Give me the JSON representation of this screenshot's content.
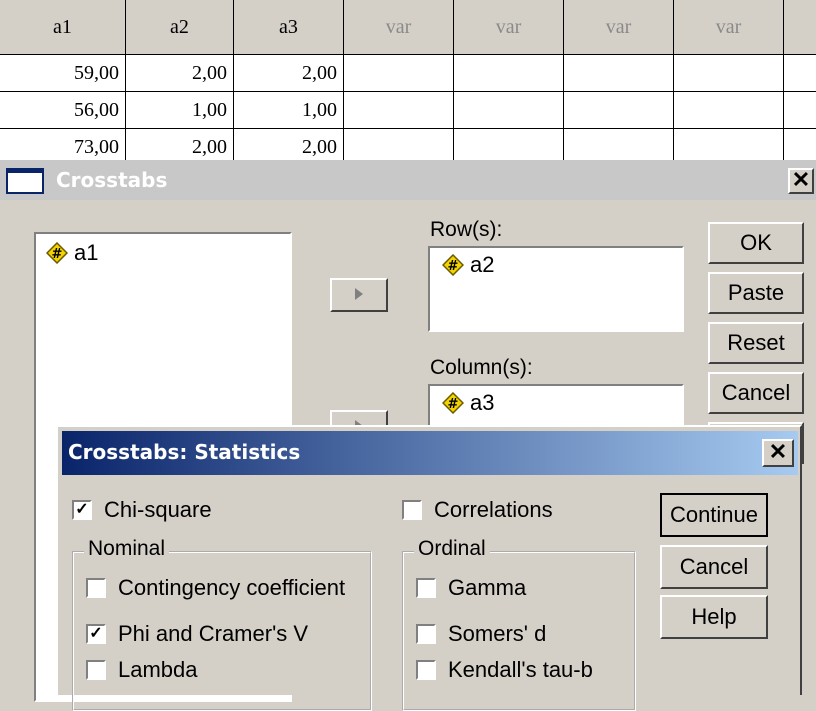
{
  "grid": {
    "headers": [
      "a1",
      "a2",
      "a3",
      "var",
      "var",
      "var",
      "var"
    ],
    "rows": [
      [
        "59,00",
        "2,00",
        "2,00"
      ],
      [
        "56,00",
        "1,00",
        "1,00"
      ],
      [
        "73,00",
        "2,00",
        "2,00"
      ]
    ]
  },
  "crosstabs": {
    "title": "Crosstabs",
    "close_label": "✕",
    "source_list": [
      "a1"
    ],
    "rows_label": "Row(s):",
    "rows_items": [
      "a2"
    ],
    "columns_label": "Column(s):",
    "columns_items": [
      "a3"
    ],
    "buttons": {
      "ok": "OK",
      "paste": "Paste",
      "reset": "Reset",
      "cancel": "Cancel"
    }
  },
  "statistics": {
    "title": "Crosstabs: Statistics",
    "close_label": "✕",
    "chi_square": {
      "label": "Chi-square",
      "checked": true
    },
    "correlations": {
      "label": "Correlations",
      "checked": false
    },
    "nominal_label": "Nominal",
    "ordinal_label": "Ordinal",
    "nominal": [
      {
        "label": "Contingency coefficient",
        "checked": false
      },
      {
        "label": "Phi and Cramer's V",
        "checked": true
      },
      {
        "label": "Lambda",
        "checked": false
      }
    ],
    "ordinal": [
      {
        "label": "Gamma",
        "checked": false
      },
      {
        "label": "Somers' d",
        "checked": false
      },
      {
        "label": "Kendall's tau-b",
        "checked": false
      }
    ],
    "buttons": {
      "continue": "Continue",
      "cancel": "Cancel",
      "help": "Help"
    }
  },
  "colors": {
    "title_active": "#0a246a",
    "title_gradient_end": "#a6caf0",
    "title_inactive": "#c8c8c8",
    "face": "#d4d0c8",
    "var_icon": "#f2d200"
  }
}
